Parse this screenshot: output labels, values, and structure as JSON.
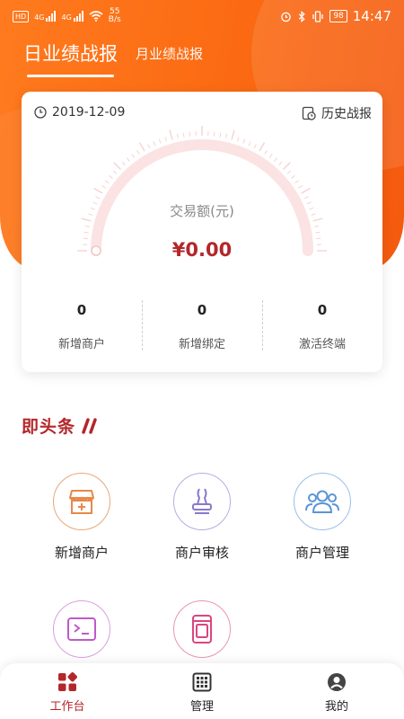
{
  "status_bar": {
    "hd": "HD",
    "net1": "4G",
    "net2": "4G",
    "speed_value": "55",
    "speed_unit": "B/s",
    "battery": "98",
    "time": "14:47"
  },
  "tabs": [
    {
      "label": "日业绩战报",
      "active": true
    },
    {
      "label": "月业绩战报",
      "active": false
    }
  ],
  "report": {
    "date": "2019-12-09",
    "history_label": "历史战报",
    "gauge_label": "交易额(元)",
    "amount": "¥0.00",
    "gauge_progress": 0,
    "stats": [
      {
        "value": "0",
        "label": "新增商户"
      },
      {
        "value": "0",
        "label": "新增绑定"
      },
      {
        "value": "0",
        "label": "激活终端"
      }
    ]
  },
  "headline": {
    "title": "即头条"
  },
  "grid": [
    {
      "label": "新增商户",
      "icon": "shop-add-icon",
      "color": "#e8894a"
    },
    {
      "label": "商户审核",
      "icon": "stamp-icon",
      "color": "#8a79c9"
    },
    {
      "label": "商户管理",
      "icon": "users-icon",
      "color": "#5b95d8"
    },
    {
      "label": "",
      "icon": "terminal-icon",
      "color": "#c059c9"
    },
    {
      "label": "",
      "icon": "device-icon",
      "color": "#d9477e"
    }
  ],
  "bottom_nav": [
    {
      "label": "工作台",
      "icon": "workbench-icon",
      "active": true
    },
    {
      "label": "管理",
      "icon": "manage-grid-icon",
      "active": false
    },
    {
      "label": "我的",
      "icon": "profile-icon",
      "active": false
    }
  ],
  "colors": {
    "brand_orange": "#fb6a12",
    "accent_red": "#b3272b"
  }
}
